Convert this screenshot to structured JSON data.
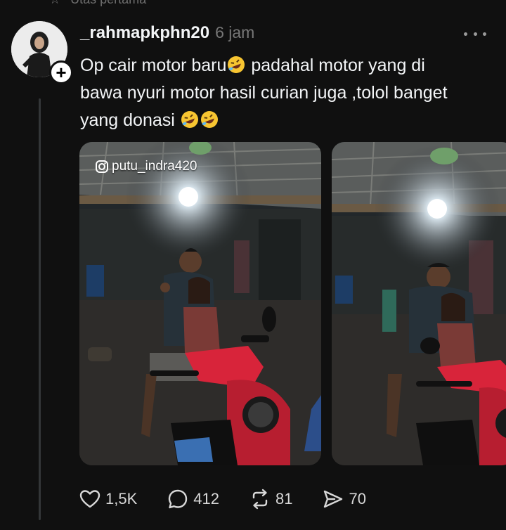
{
  "top_cut_text": "Utas pertama",
  "post": {
    "username": "_rahmapkphn20",
    "time": "6 jam",
    "text_line1_a": "Op cair motor baru",
    "text_line1_b": " padahal motor yang di",
    "text_line2": "bawa nyuri motor hasil curian juga ,tolol banget",
    "text_line3": "yang donasi ",
    "media_watermark": "putu_indra420"
  },
  "actions": {
    "likes": "1,5K",
    "replies": "412",
    "reposts": "81",
    "shares": "70"
  },
  "icons": [
    "plus-icon",
    "more-icon",
    "heart-icon",
    "comment-icon",
    "repost-icon",
    "send-icon",
    "instagram-icon",
    "rofl-emoji"
  ],
  "colors": {
    "background": "#101010",
    "text": "#f3f5f7",
    "muted": "#777777",
    "scooter_red": "#d8243a"
  }
}
